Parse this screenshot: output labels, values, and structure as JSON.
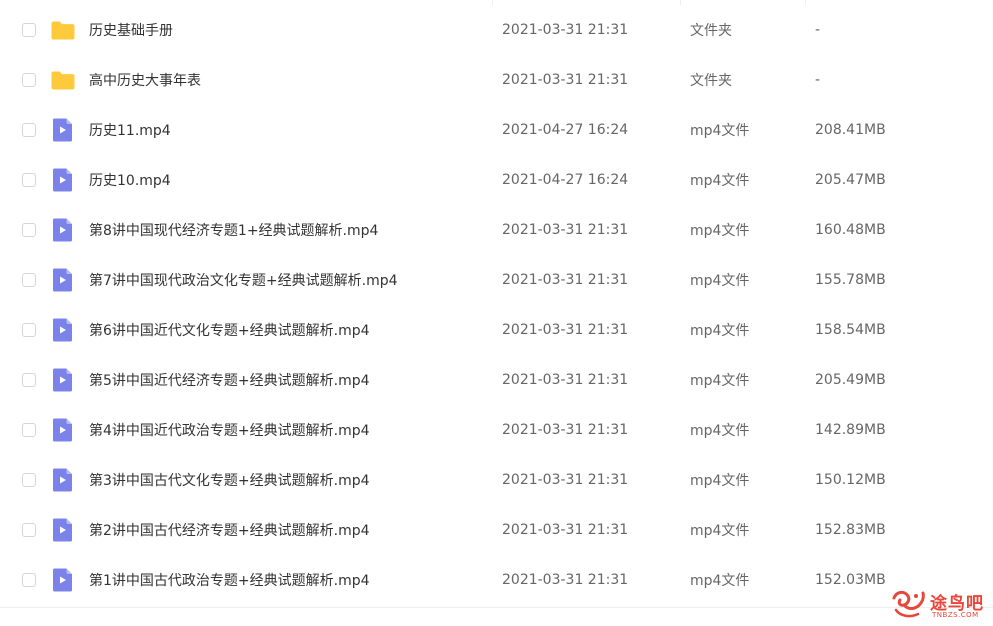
{
  "files": [
    {
      "name": "历史基础手册",
      "date": "2021-03-31 21:31",
      "type": "文件夹",
      "size": "-",
      "icon": "folder-icon"
    },
    {
      "name": "高中历史大事年表",
      "date": "2021-03-31 21:31",
      "type": "文件夹",
      "size": "-",
      "icon": "folder-icon"
    },
    {
      "name": "历史11.mp4",
      "date": "2021-04-27 16:24",
      "type": "mp4文件",
      "size": "208.41MB",
      "icon": "video-file-icon"
    },
    {
      "name": "历史10.mp4",
      "date": "2021-04-27 16:24",
      "type": "mp4文件",
      "size": "205.47MB",
      "icon": "video-file-icon"
    },
    {
      "name": "第8讲中国现代经济专题1+经典试题解析.mp4",
      "date": "2021-03-31 21:31",
      "type": "mp4文件",
      "size": "160.48MB",
      "icon": "video-file-icon"
    },
    {
      "name": "第7讲中国现代政治文化专题+经典试题解析.mp4",
      "date": "2021-03-31 21:31",
      "type": "mp4文件",
      "size": "155.78MB",
      "icon": "video-file-icon"
    },
    {
      "name": "第6讲中国近代文化专题+经典试题解析.mp4",
      "date": "2021-03-31 21:31",
      "type": "mp4文件",
      "size": "158.54MB",
      "icon": "video-file-icon"
    },
    {
      "name": "第5讲中国近代经济专题+经典试题解析.mp4",
      "date": "2021-03-31 21:31",
      "type": "mp4文件",
      "size": "205.49MB",
      "icon": "video-file-icon"
    },
    {
      "name": "第4讲中国近代政治专题+经典试题解析.mp4",
      "date": "2021-03-31 21:31",
      "type": "mp4文件",
      "size": "142.89MB",
      "icon": "video-file-icon"
    },
    {
      "name": "第3讲中国古代文化专题+经典试题解析.mp4",
      "date": "2021-03-31 21:31",
      "type": "mp4文件",
      "size": "150.12MB",
      "icon": "video-file-icon"
    },
    {
      "name": "第2讲中国古代经济专题+经典试题解析.mp4",
      "date": "2021-03-31 21:31",
      "type": "mp4文件",
      "size": "152.83MB",
      "icon": "video-file-icon"
    },
    {
      "name": "第1讲中国古代政治专题+经典试题解析.mp4",
      "date": "2021-03-31 21:31",
      "type": "mp4文件",
      "size": "152.03MB",
      "icon": "video-file-icon"
    }
  ],
  "watermark": {
    "text_cn": "途鸟吧",
    "text_en": "TNBZS.COM",
    "icon": "bird-logo-icon",
    "color": "#e8463a"
  },
  "colors": {
    "folder": "#ffc93c",
    "video_file": "#7b83eb",
    "checkbox_border": "#d6d6d6"
  }
}
